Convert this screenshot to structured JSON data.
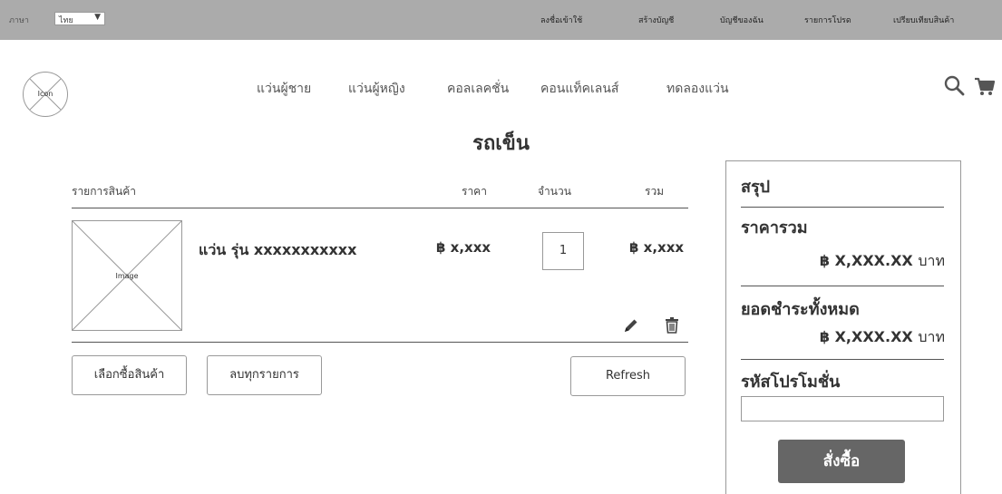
{
  "topbar": {
    "language_label": "ภาษา",
    "language_value": "ไทย",
    "links": [
      "ลงชื่อเข้าใช้",
      "สร้างบัญชี",
      "บัญชีของฉัน",
      "รายการโปรด",
      "เปรียบเทียบสินค้า"
    ]
  },
  "header": {
    "logo_label": "Icon",
    "nav": [
      "แว่นผู้ชาย",
      "แว่นผู้หญิง",
      "คอลเลคชั่น",
      "คอนแท็คเลนส์",
      "ทดลองแว่น"
    ],
    "icons": [
      "search-icon",
      "cart-icon"
    ]
  },
  "page": {
    "title": "รถเข็น"
  },
  "cart": {
    "columns": [
      "รายการสินค้า",
      "ราคา",
      "จำนวน",
      "รวม"
    ],
    "items": [
      {
        "image_label": "Image",
        "name": "แว่น รุ่น xxxxxxxxxxx",
        "price": "฿ x,xxx",
        "quantity": "1",
        "total": "฿ x,xxx",
        "actions": [
          "pencil-icon",
          "trash-icon"
        ]
      }
    ],
    "buttons": {
      "continue_shopping": "เลือกซื้อสินค้า",
      "delete_all": "ลบทุกรายการ",
      "refresh": "Refresh"
    }
  },
  "summary": {
    "title": "สรุป",
    "total_label": "ราคารวม",
    "total_value": "฿ X,XXX.XX",
    "grand_total_label": "ยอดชำระทั้งหมด",
    "grand_total_value": "฿ X,XXX.XX",
    "currency_unit": "บาท",
    "promo_label": "รหัสโปรโมชั่น",
    "promo_value": "",
    "order_button": "สั่งซื้อ"
  },
  "colors": {
    "topbar_bg": "#ababab",
    "order_button_bg": "#666666",
    "border": "#999999",
    "text": "#333333"
  }
}
